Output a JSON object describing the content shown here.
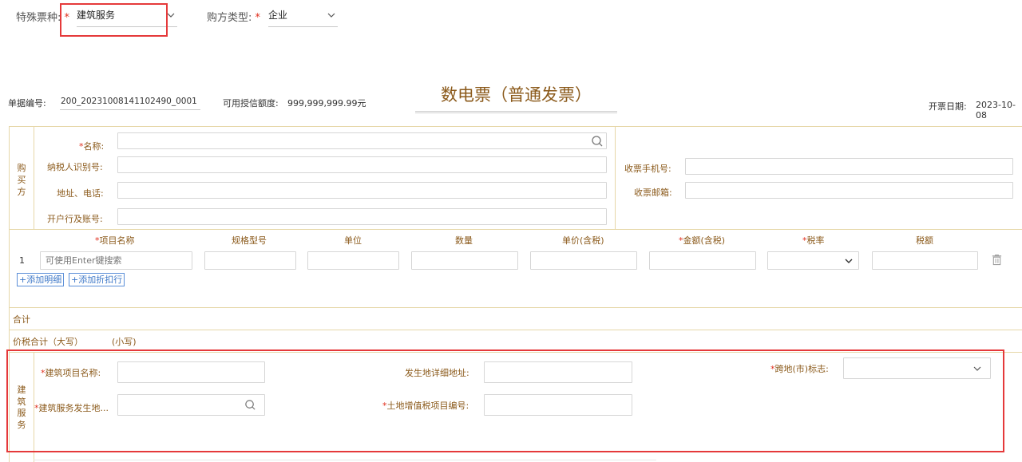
{
  "top_filters": {
    "ticket_type_label": "特殊票种:",
    "ticket_type_value": "建筑服务",
    "buyer_type_label": "购方类型:",
    "buyer_type_value": "企业",
    "required_mark": "*"
  },
  "header": {
    "doc_no_label": "单据编号:",
    "doc_no_value": "200_20231008141102490_0001",
    "credit_label": "可用授信额度:",
    "credit_value": "999,999,999.99元",
    "title": "数电票（普通发票）",
    "date_label": "开票日期:",
    "date_value": "2023-10-08"
  },
  "buyer": {
    "side_label": [
      "购",
      "买",
      "方"
    ],
    "name_label": "名称:",
    "taxid_label": "纳税人识别号:",
    "address_label": "地址、电话:",
    "bank_label": "开户行及账号:",
    "phone_label": "收票手机号:",
    "email_label": "收票邮箱:"
  },
  "items": {
    "columns": [
      "项目名称",
      "规格型号",
      "单位",
      "数量",
      "单价(含税)",
      "金额(含税)",
      "税率",
      "税额"
    ],
    "required_columns": [
      true,
      false,
      false,
      false,
      false,
      true,
      true,
      false
    ],
    "row_number": "1",
    "name_placeholder": "可使用Enter键搜索",
    "add_detail": "+添加明细",
    "add_discount": "+添加折扣行"
  },
  "totals": {
    "sum_label": "合计",
    "total_label": "价税合计（大写）",
    "small_label": "(小写)"
  },
  "construction": {
    "side_label": [
      "建",
      "筑",
      "服",
      "务"
    ],
    "project_name_label": "建筑项目名称:",
    "location_label": "建筑服务发生地...",
    "detail_address_label": "发生地详细地址:",
    "land_tax_label": "土地增值税项目编号:",
    "cross_region_label": "跨地(市)标志:"
  },
  "colors": {
    "label_brown": "#8b5a1b",
    "required_red": "#e0301e",
    "highlight_red": "#e5393a",
    "border_gold": "#e6d7a8",
    "link_blue": "#3e78c8"
  }
}
